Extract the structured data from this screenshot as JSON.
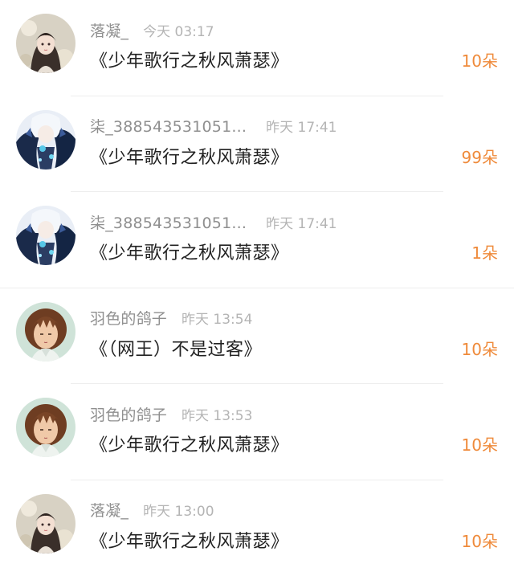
{
  "gifts": [
    {
      "username": "落凝_",
      "time": "今天 03:17",
      "title": "《少年歌行之秋风萧瑟》",
      "count": "10朵",
      "avatar": "avatar-girl-flowers"
    },
    {
      "username": "柒_388543531051...",
      "time": "昨天 17:41",
      "title": "《少年歌行之秋风萧瑟》",
      "count": "99朵",
      "avatar": "avatar-anime-blue"
    },
    {
      "username": "柒_388543531051...",
      "time": "昨天 17:41",
      "title": "《少年歌行之秋风萧瑟》",
      "count": "1朵",
      "avatar": "avatar-anime-blue"
    },
    {
      "username": "羽色的鸽子",
      "time": "昨天 13:54",
      "title": "《（网王）不是过客》",
      "count": "10朵",
      "avatar": "avatar-anime-brown-hair"
    },
    {
      "username": "羽色的鸽子",
      "time": "昨天 13:53",
      "title": "《少年歌行之秋风萧瑟》",
      "count": "10朵",
      "avatar": "avatar-anime-brown-hair"
    },
    {
      "username": "落凝_",
      "time": "昨天 13:00",
      "title": "《少年歌行之秋风萧瑟》",
      "count": "10朵",
      "avatar": "avatar-girl-flowers"
    }
  ],
  "colors": {
    "count": "#ef8a3a",
    "username": "#8f8f8f",
    "time": "#b4b4b4",
    "title": "#222222",
    "divider": "#ededed"
  }
}
